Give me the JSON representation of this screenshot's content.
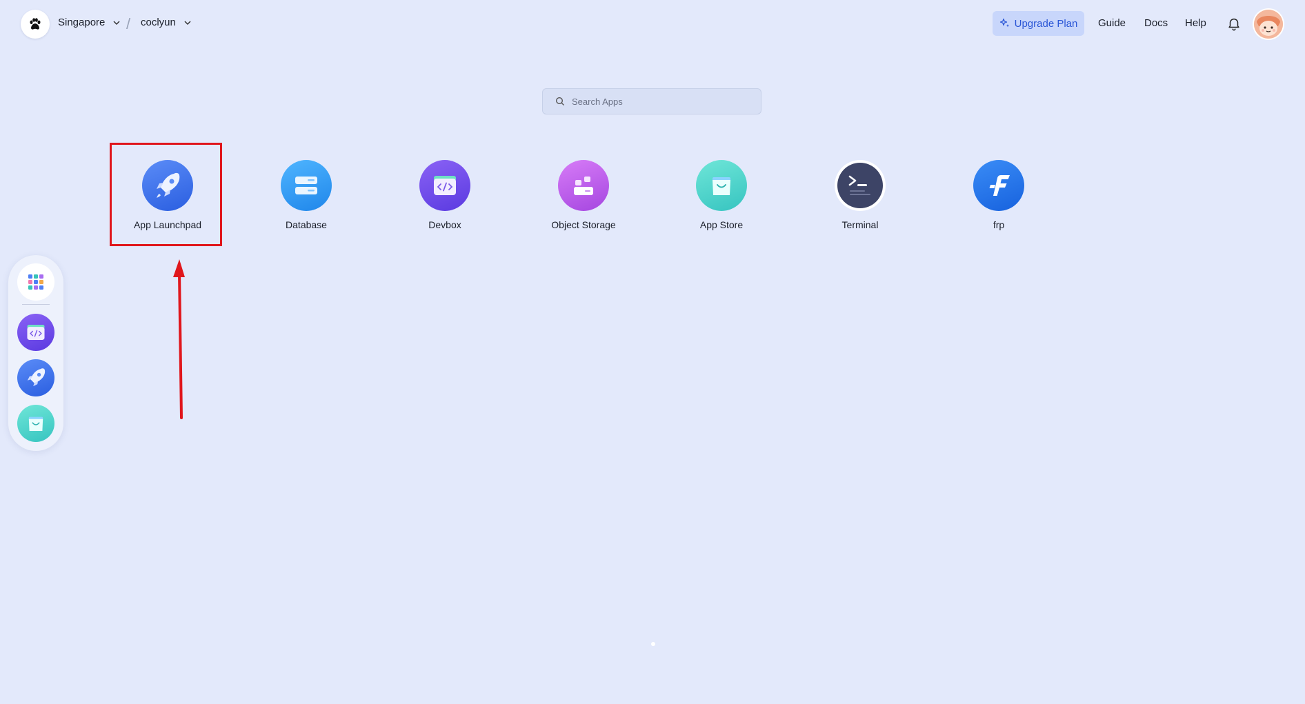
{
  "header": {
    "region": "Singapore",
    "workspace": "coclyun",
    "separator": "/",
    "upgrade_label": "Upgrade Plan",
    "guide_label": "Guide",
    "docs_label": "Docs",
    "help_label": "Help"
  },
  "search": {
    "placeholder": "Search Apps"
  },
  "apps": [
    {
      "label": "App Launchpad",
      "icon": "rocket-icon"
    },
    {
      "label": "Database",
      "icon": "database-icon"
    },
    {
      "label": "Devbox",
      "icon": "code-folder-icon"
    },
    {
      "label": "Object Storage",
      "icon": "blocks-icon"
    },
    {
      "label": "App Store",
      "icon": "shopping-bag-icon"
    },
    {
      "label": "Terminal",
      "icon": "terminal-icon"
    },
    {
      "label": "frp",
      "icon": "frp-icon"
    }
  ],
  "dock": {
    "items": [
      "app-grid-icon",
      "code-folder-icon",
      "rocket-icon",
      "shopping-bag-icon"
    ]
  },
  "colors": {
    "background": "#e3e9fb",
    "accent": "#2a56d6",
    "highlight": "#e0161c"
  }
}
